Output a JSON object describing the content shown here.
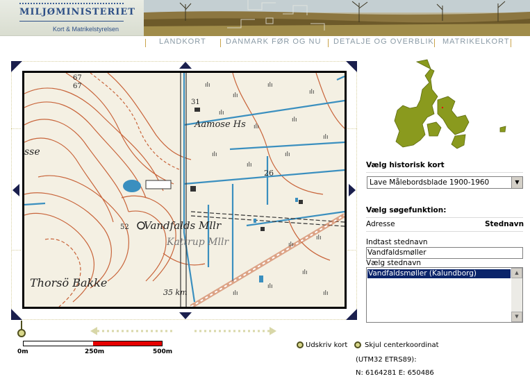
{
  "header": {
    "logo_title": "MILJØMINISTERIET",
    "logo_subtitle": "Kort & Matrikelstyrelsen"
  },
  "nav": {
    "items": [
      "LANDKORT",
      "DANMARK FØR OG NU",
      "DETALJE OG OVERBLIK",
      "MATRIKELKORT"
    ]
  },
  "map": {
    "labels": {
      "elevation_67a": "67",
      "elevation_67b": "67",
      "number_31": "31",
      "aamose": "Aamose Hs",
      "number_26": "26",
      "elevation_52": "52",
      "vandfalds": "Vandfalds Mllr",
      "kattrup": "Kattrup Mllr",
      "thorso": "Thorsö Bakke",
      "km": "35 km",
      "sse": "sse"
    }
  },
  "scale": {
    "label_0": "0m",
    "label_250": "250m",
    "label_500": "500m"
  },
  "actions": {
    "print_label": "Udskriv kort",
    "hide_coord_label": "Skjul centerkoordinat",
    "crs_label": "(UTM32 ETRS89):",
    "coords_text": "N:  6164281  E:  650486"
  },
  "panel": {
    "historic_label": "Vælg historisk kort",
    "historic_value": "Lave Målebordsblade 1900-1960",
    "search_label": "Vælg søgefunktion:",
    "search_address": "Adresse",
    "search_placename": "Stednavn",
    "input_label": "Indtast stednavn",
    "input_value": "Vandfaldsmøller",
    "list_label": "Vælg stednavn",
    "list_items": [
      "Vandfaldsmøller (Kalundborg)"
    ]
  },
  "colors": {
    "accent_blue": "#2d4f86",
    "nav_text": "#8a9aa5",
    "scale_red": "#e60000",
    "selection": "#0a246a",
    "map_contour": "#c8643a",
    "map_water": "#3a8fbf",
    "minimap_land": "#8a9a1e"
  },
  "icons": {
    "pan_arrows": "triangle-arrow-icon",
    "corner": "corner-zoom-icon",
    "radio": "radio-dot-icon",
    "pin": "location-pin-icon"
  }
}
